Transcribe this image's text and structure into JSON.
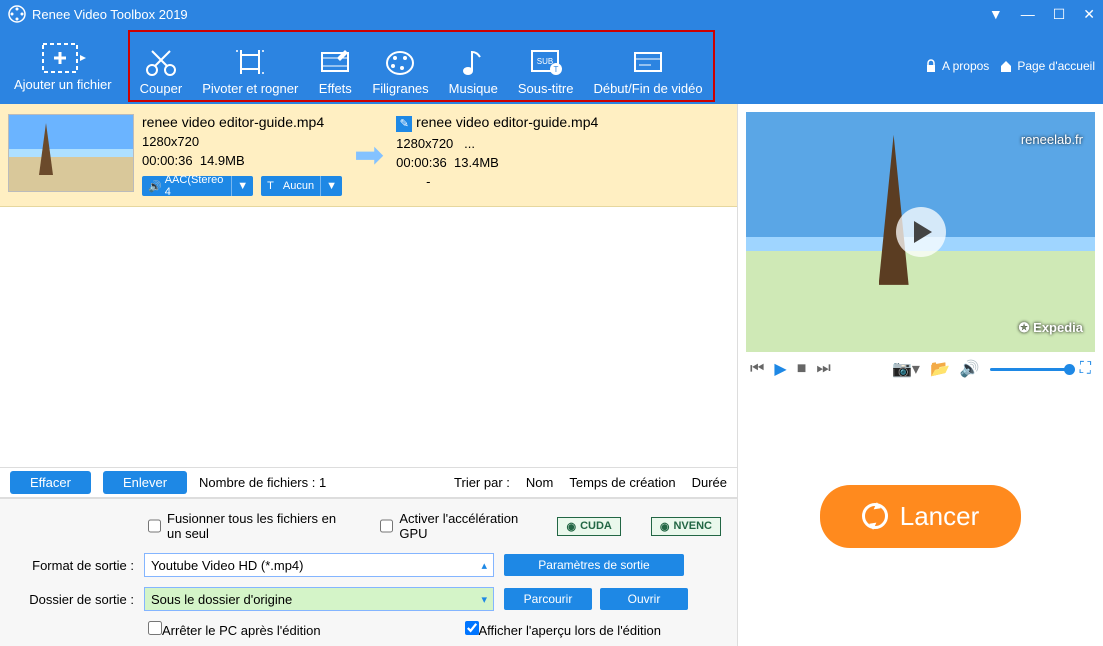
{
  "title": "Renee Video Toolbox 2019",
  "toolbar": {
    "add_file": "Ajouter un fichier",
    "items": [
      "Couper",
      "Pivoter et rogner",
      "Effets",
      "Filigranes",
      "Musique",
      "Sous-titre",
      "Début/Fin de vidéo"
    ],
    "about": "A propos",
    "home": "Page d'accueil"
  },
  "file": {
    "src": {
      "name": "renee video editor-guide.mp4",
      "res": "1280x720",
      "dur": "00:00:36",
      "size": "14.9MB",
      "audio_chip": "AAC(Stereo 4",
      "sub_chip": "Aucun"
    },
    "dst": {
      "name": "renee video editor-guide.mp4",
      "res": "1280x720",
      "res_more": "...",
      "dur": "00:00:36",
      "size": "13.4MB",
      "dash": "-"
    }
  },
  "list_footer": {
    "clear": "Effacer",
    "remove": "Enlever",
    "count": "Nombre de fichiers : 1",
    "sort_label": "Trier par :",
    "sort_name": "Nom",
    "sort_time": "Temps de création",
    "sort_duration": "Durée"
  },
  "options": {
    "merge": "Fusionner tous les fichiers en un seul",
    "gpu": "Activer l'accélération GPU",
    "cuda": "CUDA",
    "nvenc": "NVENC",
    "format_label": "Format de sortie :",
    "format_value": "Youtube Video HD (*.mp4)",
    "params": "Paramètres de sortie",
    "folder_label": "Dossier de sortie :",
    "folder_value": "Sous le dossier d'origine",
    "browse": "Parcourir",
    "open": "Ouvrir",
    "shutdown": "Arrêter le PC après l'édition",
    "preview": "Afficher l'aperçu lors de l'édition"
  },
  "preview": {
    "wmk1": "reneelab.fr",
    "wmk2": "✪ Expedia"
  },
  "launch": "Lancer"
}
